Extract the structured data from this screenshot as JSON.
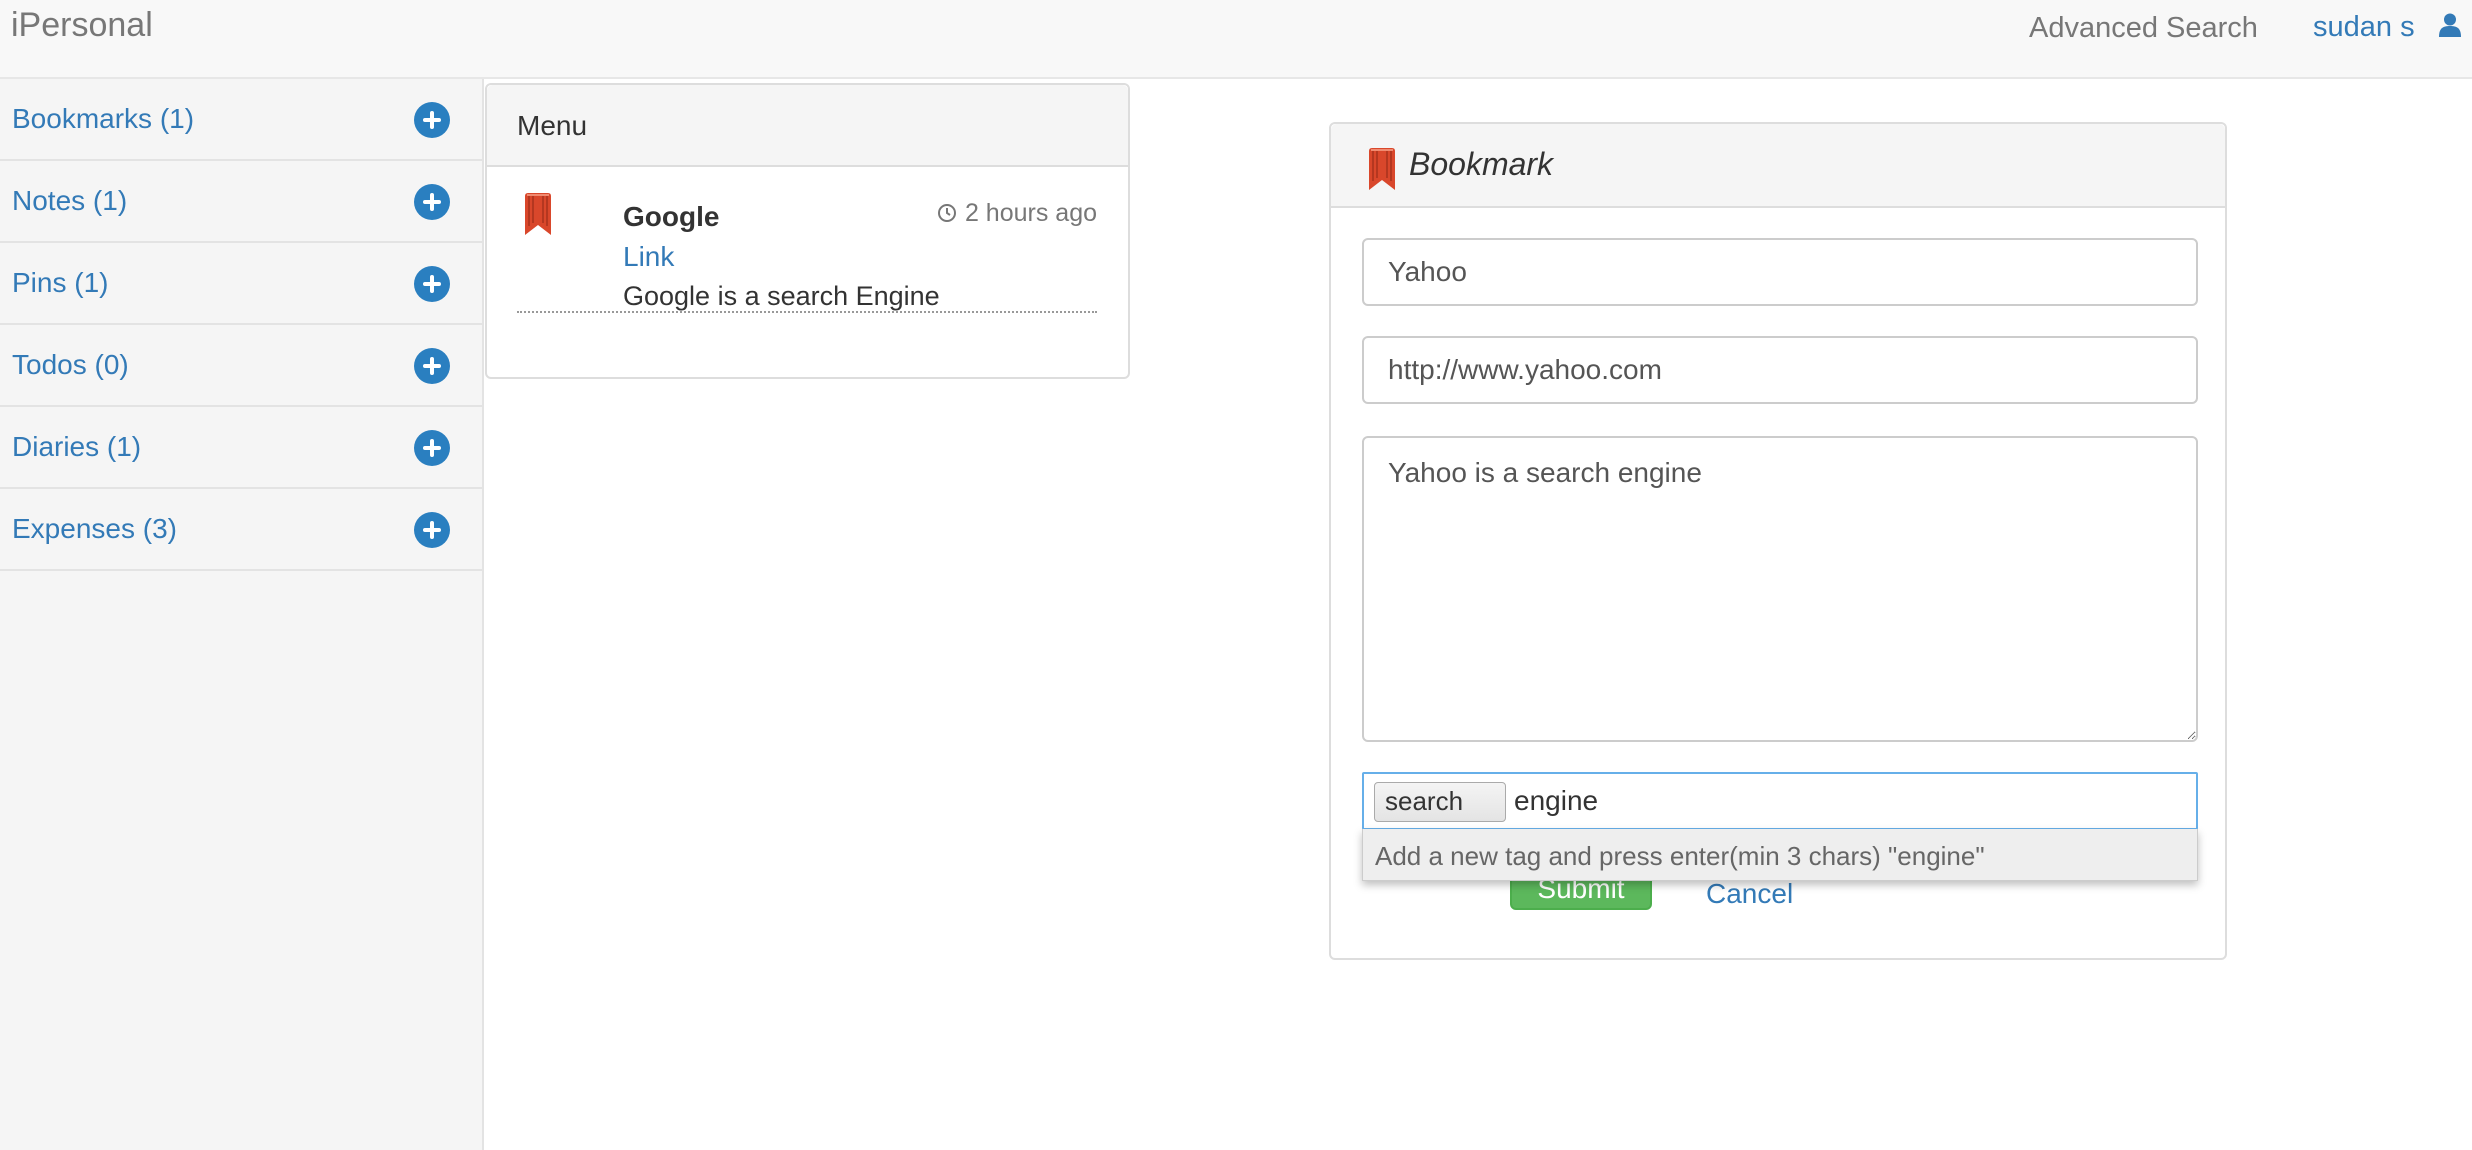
{
  "navbar": {
    "brand": "iPersonal",
    "advanced_search": "Advanced Search",
    "user_name": "sudan s"
  },
  "sidebar": {
    "items": [
      {
        "label": "Bookmarks (1)"
      },
      {
        "label": "Notes (1)"
      },
      {
        "label": "Pins (1)"
      },
      {
        "label": "Todos (0)"
      },
      {
        "label": "Diaries (1)"
      },
      {
        "label": "Expenses (3)"
      }
    ]
  },
  "menu": {
    "heading": "Menu",
    "entry": {
      "title": "Google",
      "time": "2 hours ago",
      "link_label": "Link",
      "description": "Google is a search Engine"
    }
  },
  "form": {
    "heading": "Bookmark",
    "name_value": "Yahoo",
    "url_value": "http://www.yahoo.com",
    "description_value": "Yahoo is a search engine",
    "tag_chip": "search",
    "tag_input_value": "engine",
    "tag_suggestion": "Add a new tag and press enter(min 3 chars) \"engine\"",
    "submit_label": "Submit",
    "cancel_label": "Cancel"
  },
  "colors": {
    "link": "#337ab7",
    "add_icon": "#2a7fc0",
    "submit": "#5cb85c",
    "bookmark_icon": "#d9472b",
    "focus_border": "#66afe9"
  }
}
